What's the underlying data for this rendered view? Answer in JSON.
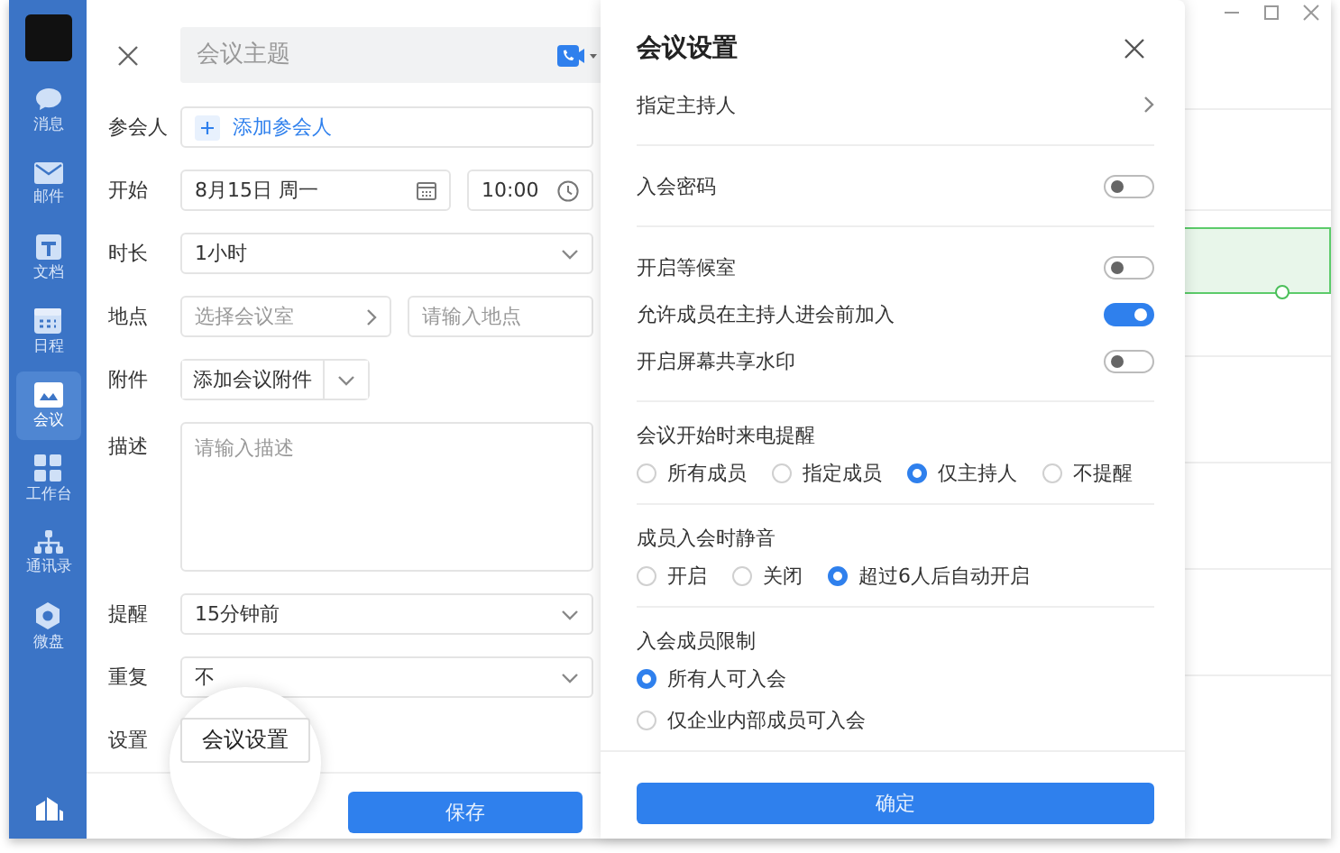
{
  "sidebar": {
    "items": [
      {
        "label": "消息",
        "selected": false
      },
      {
        "label": "邮件",
        "selected": false
      },
      {
        "label": "文档",
        "selected": false
      },
      {
        "label": "日程",
        "selected": false
      },
      {
        "label": "会议",
        "selected": true
      },
      {
        "label": "工作台",
        "selected": false
      },
      {
        "label": "通讯录",
        "selected": false
      },
      {
        "label": "微盘",
        "selected": false
      }
    ]
  },
  "form": {
    "title_placeholder": "会议主题",
    "fields": [
      {
        "kind": "attendees",
        "label": "参会人",
        "action": "添加参会人"
      },
      {
        "kind": "datetime",
        "label": "开始",
        "date": "8月15日 周一",
        "time": "10:00"
      },
      {
        "kind": "select",
        "label": "时长",
        "value": "1小时"
      },
      {
        "kind": "location",
        "label": "地点",
        "room_placeholder": "选择会议室",
        "address_placeholder": "请输入地点"
      },
      {
        "kind": "attachment",
        "label": "附件",
        "value": "添加会议附件"
      },
      {
        "kind": "textarea",
        "label": "描述",
        "placeholder": "请输入描述"
      },
      {
        "kind": "select",
        "label": "提醒",
        "value": "15分钟前"
      },
      {
        "kind": "select",
        "label": "重复",
        "value": "不"
      },
      {
        "kind": "button",
        "label": "设置",
        "value": "会议设置"
      }
    ],
    "save": "保存"
  },
  "settings": {
    "title": "会议设置",
    "sections": [
      {
        "items": [
          {
            "kind": "link",
            "label": "指定主持人"
          }
        ]
      },
      {
        "items": [
          {
            "kind": "toggle",
            "label": "入会密码",
            "on": false
          }
        ]
      },
      {
        "items": [
          {
            "kind": "toggle",
            "label": "开启等候室",
            "on": false
          },
          {
            "kind": "toggle",
            "label": "允许成员在主持人进会前加入",
            "on": true
          },
          {
            "kind": "toggle",
            "label": "开启屏幕共享水印",
            "on": false
          }
        ]
      },
      {
        "items": [
          {
            "kind": "radio",
            "label": "会议开始时来电提醒",
            "options": [
              {
                "label": "所有成员",
                "selected": false
              },
              {
                "label": "指定成员",
                "selected": false
              },
              {
                "label": "仅主持人",
                "selected": true
              },
              {
                "label": "不提醒",
                "selected": false
              }
            ]
          }
        ]
      },
      {
        "items": [
          {
            "kind": "radio",
            "label": "成员入会时静音",
            "options": [
              {
                "label": "开启",
                "selected": false
              },
              {
                "label": "关闭",
                "selected": false
              },
              {
                "label": "超过6人后自动开启",
                "selected": true
              }
            ]
          }
        ]
      },
      {
        "items": [
          {
            "kind": "radio_list",
            "label": "入会成员限制",
            "options": [
              {
                "label": "所有人可入会",
                "selected": true
              },
              {
                "label": "仅企业内部成员可入会",
                "selected": false
              }
            ]
          }
        ]
      }
    ],
    "confirm": "确定"
  }
}
